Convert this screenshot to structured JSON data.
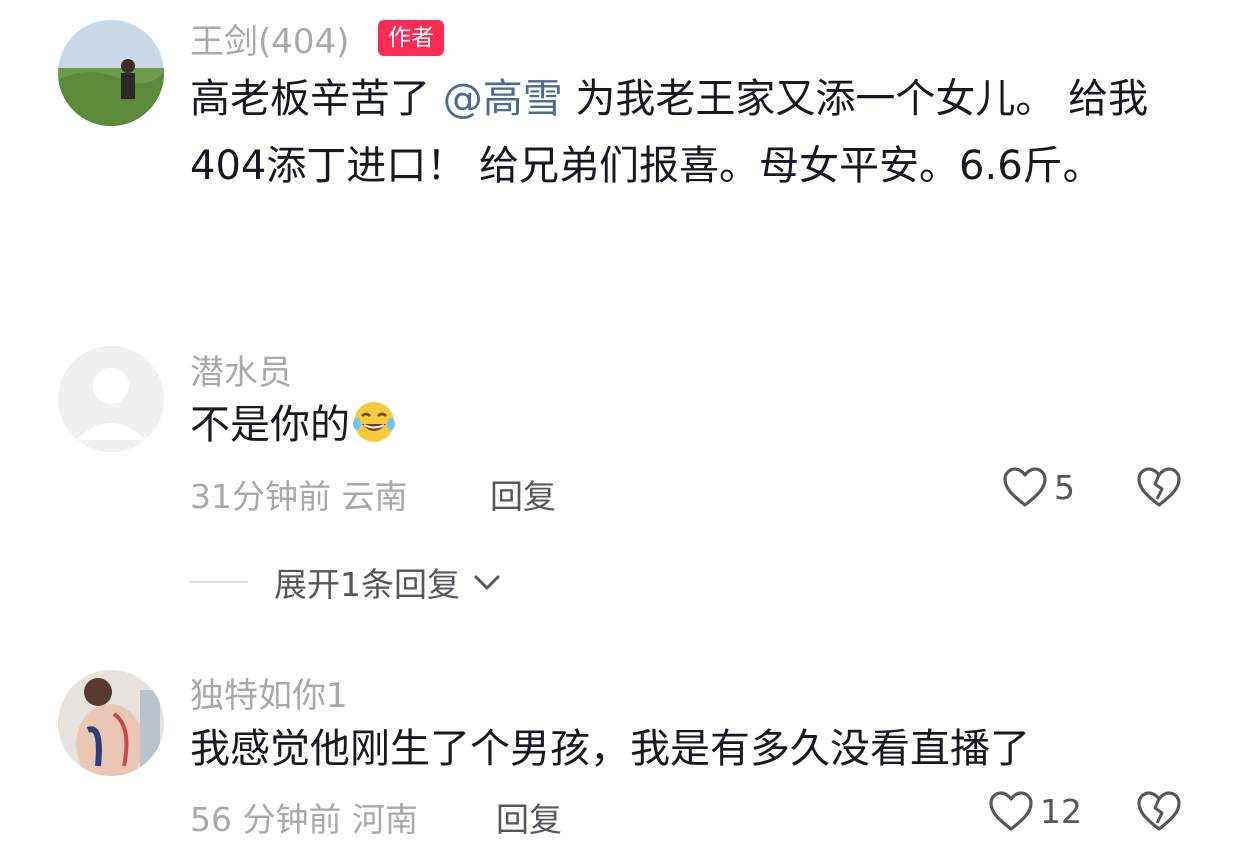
{
  "comments": [
    {
      "username": "王剑(404)",
      "badge": "作者",
      "text_before": "高老板辛苦了 ",
      "mention": "@高雪",
      "text_after": " 为我老王家又添一个女儿。 给我404添丁进口！ 给兄弟们报喜。母女平安。6.6斤。"
    },
    {
      "username": "潜水员",
      "text": "不是你的",
      "emoji": "laughing-tears-emoji",
      "time": "31分钟前",
      "location": "云南",
      "reply_label": "回复",
      "likes": "5",
      "expand_label": "展开1条回复"
    },
    {
      "username": "独特如你1",
      "text": "我感觉他刚生了个男孩，我是有多久没看直播了",
      "time": "56 分钟前",
      "location": "河南",
      "reply_label": "回复",
      "likes": "12"
    }
  ],
  "colors": {
    "badge": "#fe2c55",
    "mention": "#4b6b96",
    "meta": "#a8a9ad"
  }
}
